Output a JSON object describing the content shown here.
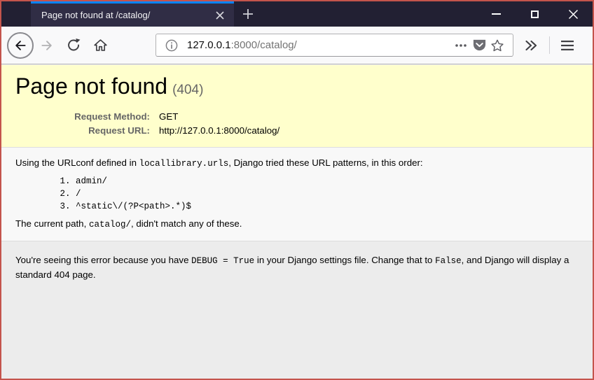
{
  "window": {
    "tab_title": "Page not found at /catalog/",
    "icons": {
      "tab_close": "close-icon",
      "new_tab": "plus-icon",
      "minimize": "minimize-icon",
      "maximize": "maximize-icon",
      "close": "close-icon"
    }
  },
  "toolbar": {
    "url": {
      "host": "127.0.0.1",
      "rest": ":8000/catalog/"
    },
    "icons": [
      "back-icon",
      "forward-icon",
      "refresh-icon",
      "home-icon",
      "info-icon",
      "page-actions-dots-icon",
      "pocket-icon",
      "bookmark-star-icon",
      "overflow-chevrons-icon",
      "hamburger-menu-icon"
    ]
  },
  "page": {
    "summary": {
      "title": "Page not found",
      "status_code": "(404)",
      "rows": [
        {
          "label": "Request Method:",
          "value": "GET"
        },
        {
          "label": "Request URL:",
          "value": "http://127.0.0.1:8000/catalog/"
        }
      ]
    },
    "info": {
      "p1_a": "Using the URLconf defined in ",
      "p1_code": "locallibrary.urls",
      "p1_b": ", Django tried these URL patterns, in this order:",
      "patterns": [
        "admin/",
        "/",
        "^static\\/(?P<path>.*)$"
      ],
      "p2_a": "The current path, ",
      "p2_code": "catalog/",
      "p2_b": ", didn't match any of these."
    },
    "explanation": {
      "a": "You're seeing this error because you have ",
      "code1": "DEBUG = True",
      "b": " in your Django settings file. Change that to ",
      "code2": "False",
      "c": ", and Django will display a standard 404 page."
    }
  },
  "colors": {
    "window_border": "#c4544c",
    "titlebar_bg": "#222033",
    "tab_bg": "#302d45",
    "tab_indicator": "#0a84ff",
    "toolbar_bg": "#f9f9fa",
    "summary_bg": "#ffffcc",
    "info_bg": "#f8f8f8",
    "explanation_bg": "#ececec",
    "divider": "#dddddd",
    "muted_text": "#666666"
  }
}
